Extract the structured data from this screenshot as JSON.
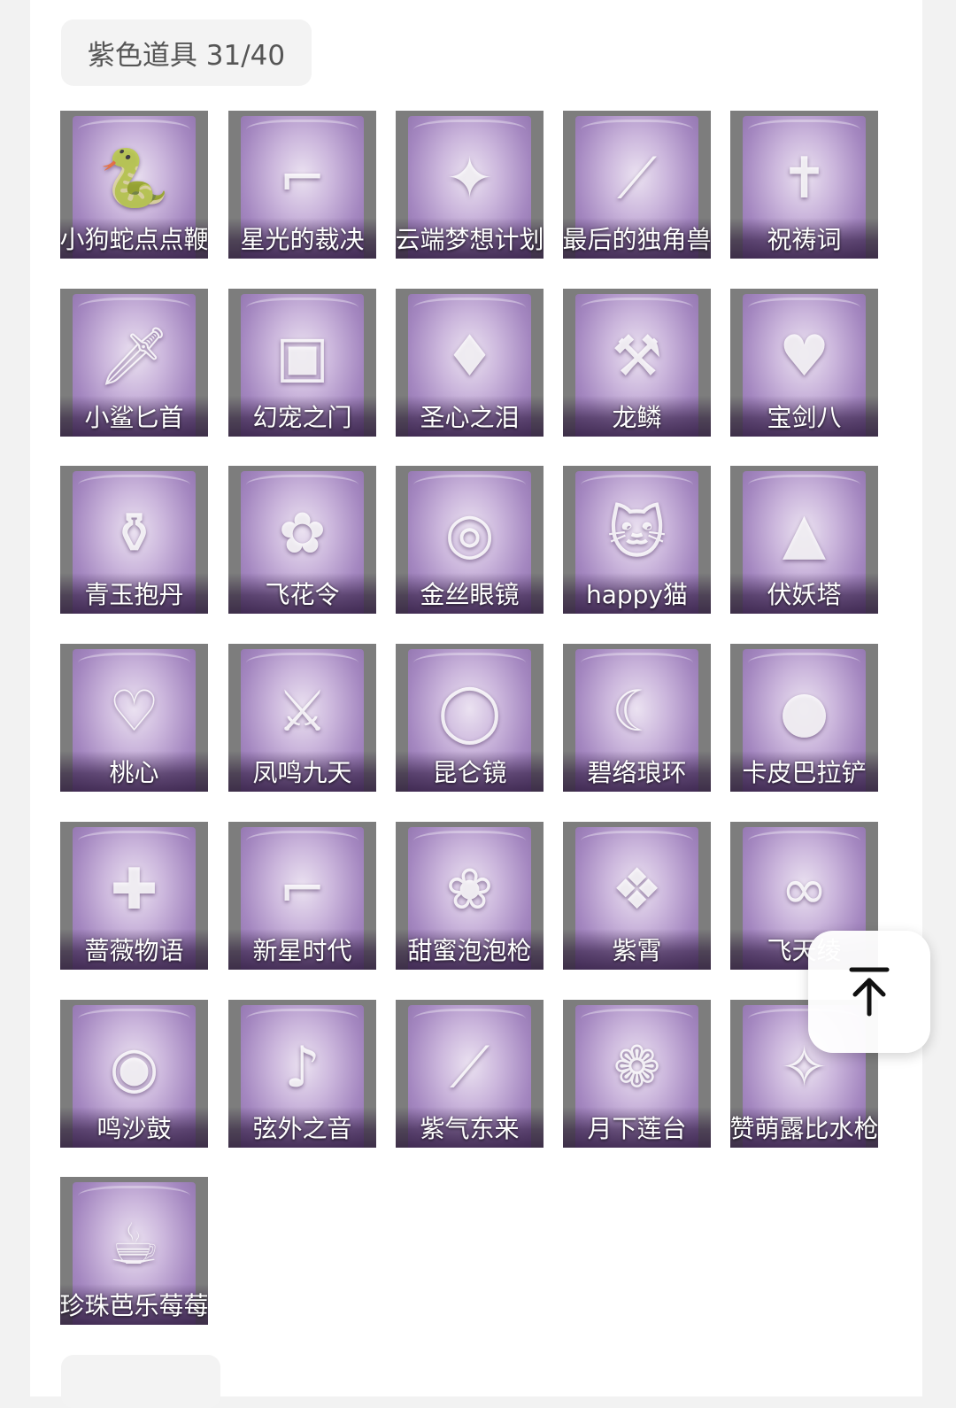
{
  "section": {
    "title": "紫色道具 31/40"
  },
  "items": [
    {
      "name": "小狗蛇点点鞭",
      "icon": "snake-figure-icon"
    },
    {
      "name": "星光的裁决",
      "icon": "gun-icon"
    },
    {
      "name": "云端梦想计划",
      "icon": "wand-icon"
    },
    {
      "name": "最后的独角兽",
      "icon": "horn-blade-icon"
    },
    {
      "name": "祝祷词",
      "icon": "cross-pendant-icon"
    },
    {
      "name": "小鲨匕首",
      "icon": "dagger-icon"
    },
    {
      "name": "幻宠之门",
      "icon": "device-icon"
    },
    {
      "name": "圣心之泪",
      "icon": "scepter-icon"
    },
    {
      "name": "龙鳞",
      "icon": "shovel-icon"
    },
    {
      "name": "宝剑八",
      "icon": "heart-shield-icon"
    },
    {
      "name": "青玉抱丹",
      "icon": "vase-icon"
    },
    {
      "name": "飞花令",
      "icon": "flower-crown-icon"
    },
    {
      "name": "金丝眼镜",
      "icon": "glasses-icon"
    },
    {
      "name": "happy猫",
      "icon": "cat-figure-icon"
    },
    {
      "name": "伏妖塔",
      "icon": "pagoda-icon"
    },
    {
      "name": "桃心",
      "icon": "heart-wand-icon"
    },
    {
      "name": "凤鸣九天",
      "icon": "red-sword-icon"
    },
    {
      "name": "昆仑镜",
      "icon": "mirror-icon"
    },
    {
      "name": "碧络琅环",
      "icon": "curved-blade-icon"
    },
    {
      "name": "卡皮巴拉铲",
      "icon": "capybara-icon"
    },
    {
      "name": "蔷薇物语",
      "icon": "medkit-icon"
    },
    {
      "name": "新星时代",
      "icon": "revolver-icon"
    },
    {
      "name": "甜蜜泡泡枪",
      "icon": "bubble-gun-icon"
    },
    {
      "name": "紫霄",
      "icon": "pendant-icon"
    },
    {
      "name": "飞天绫",
      "icon": "ribbon-icon"
    },
    {
      "name": "鸣沙鼓",
      "icon": "drum-icon"
    },
    {
      "name": "弦外之音",
      "icon": "lute-icon"
    },
    {
      "name": "紫气东来",
      "icon": "sabre-icon"
    },
    {
      "name": "月下莲台",
      "icon": "lotus-icon"
    },
    {
      "name": "赞萌露比水枪",
      "icon": "water-gun-icon"
    },
    {
      "name": "珍珠芭乐莓莓",
      "icon": "drink-cup-icon"
    }
  ],
  "back_to_top": {
    "icon": "arrow-up-to-top-icon"
  }
}
